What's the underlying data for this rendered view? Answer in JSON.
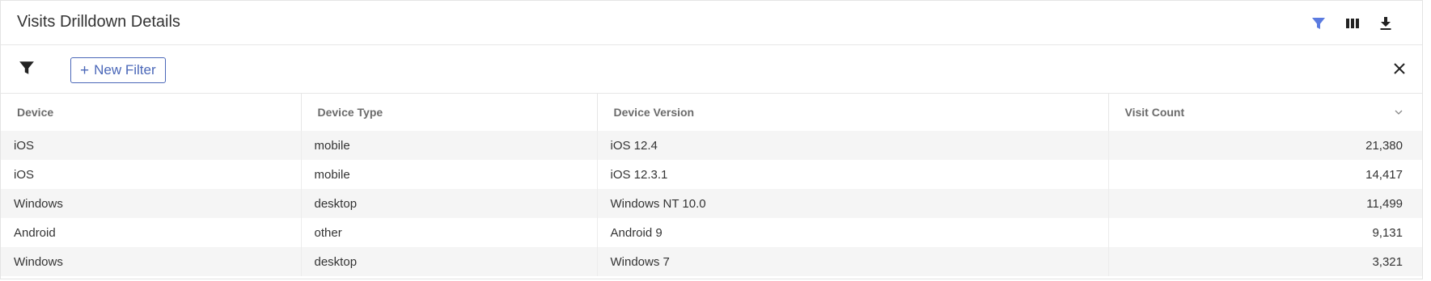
{
  "header": {
    "title": "Visits Drilldown Details",
    "accent_color": "#5b7be0",
    "icons": [
      "filter-icon",
      "columns-icon",
      "download-icon"
    ]
  },
  "filterbar": {
    "new_filter_label": "New Filter",
    "new_filter_plus": "+",
    "button_color": "#4a67b8"
  },
  "table": {
    "columns": [
      "Device",
      "Device Type",
      "Device Version",
      "Visit Count"
    ],
    "sort_column": "Visit Count",
    "sort_direction": "descending",
    "rows": [
      [
        "iOS",
        "mobile",
        "iOS 12.4",
        "21,380"
      ],
      [
        "iOS",
        "mobile",
        "iOS 12.3.1",
        "14,417"
      ],
      [
        "Windows",
        "desktop",
        "Windows NT 10.0",
        "11,499"
      ],
      [
        "Android",
        "other",
        "Android 9",
        "9,131"
      ],
      [
        "Windows",
        "desktop",
        "Windows 7",
        "3,321"
      ]
    ]
  }
}
